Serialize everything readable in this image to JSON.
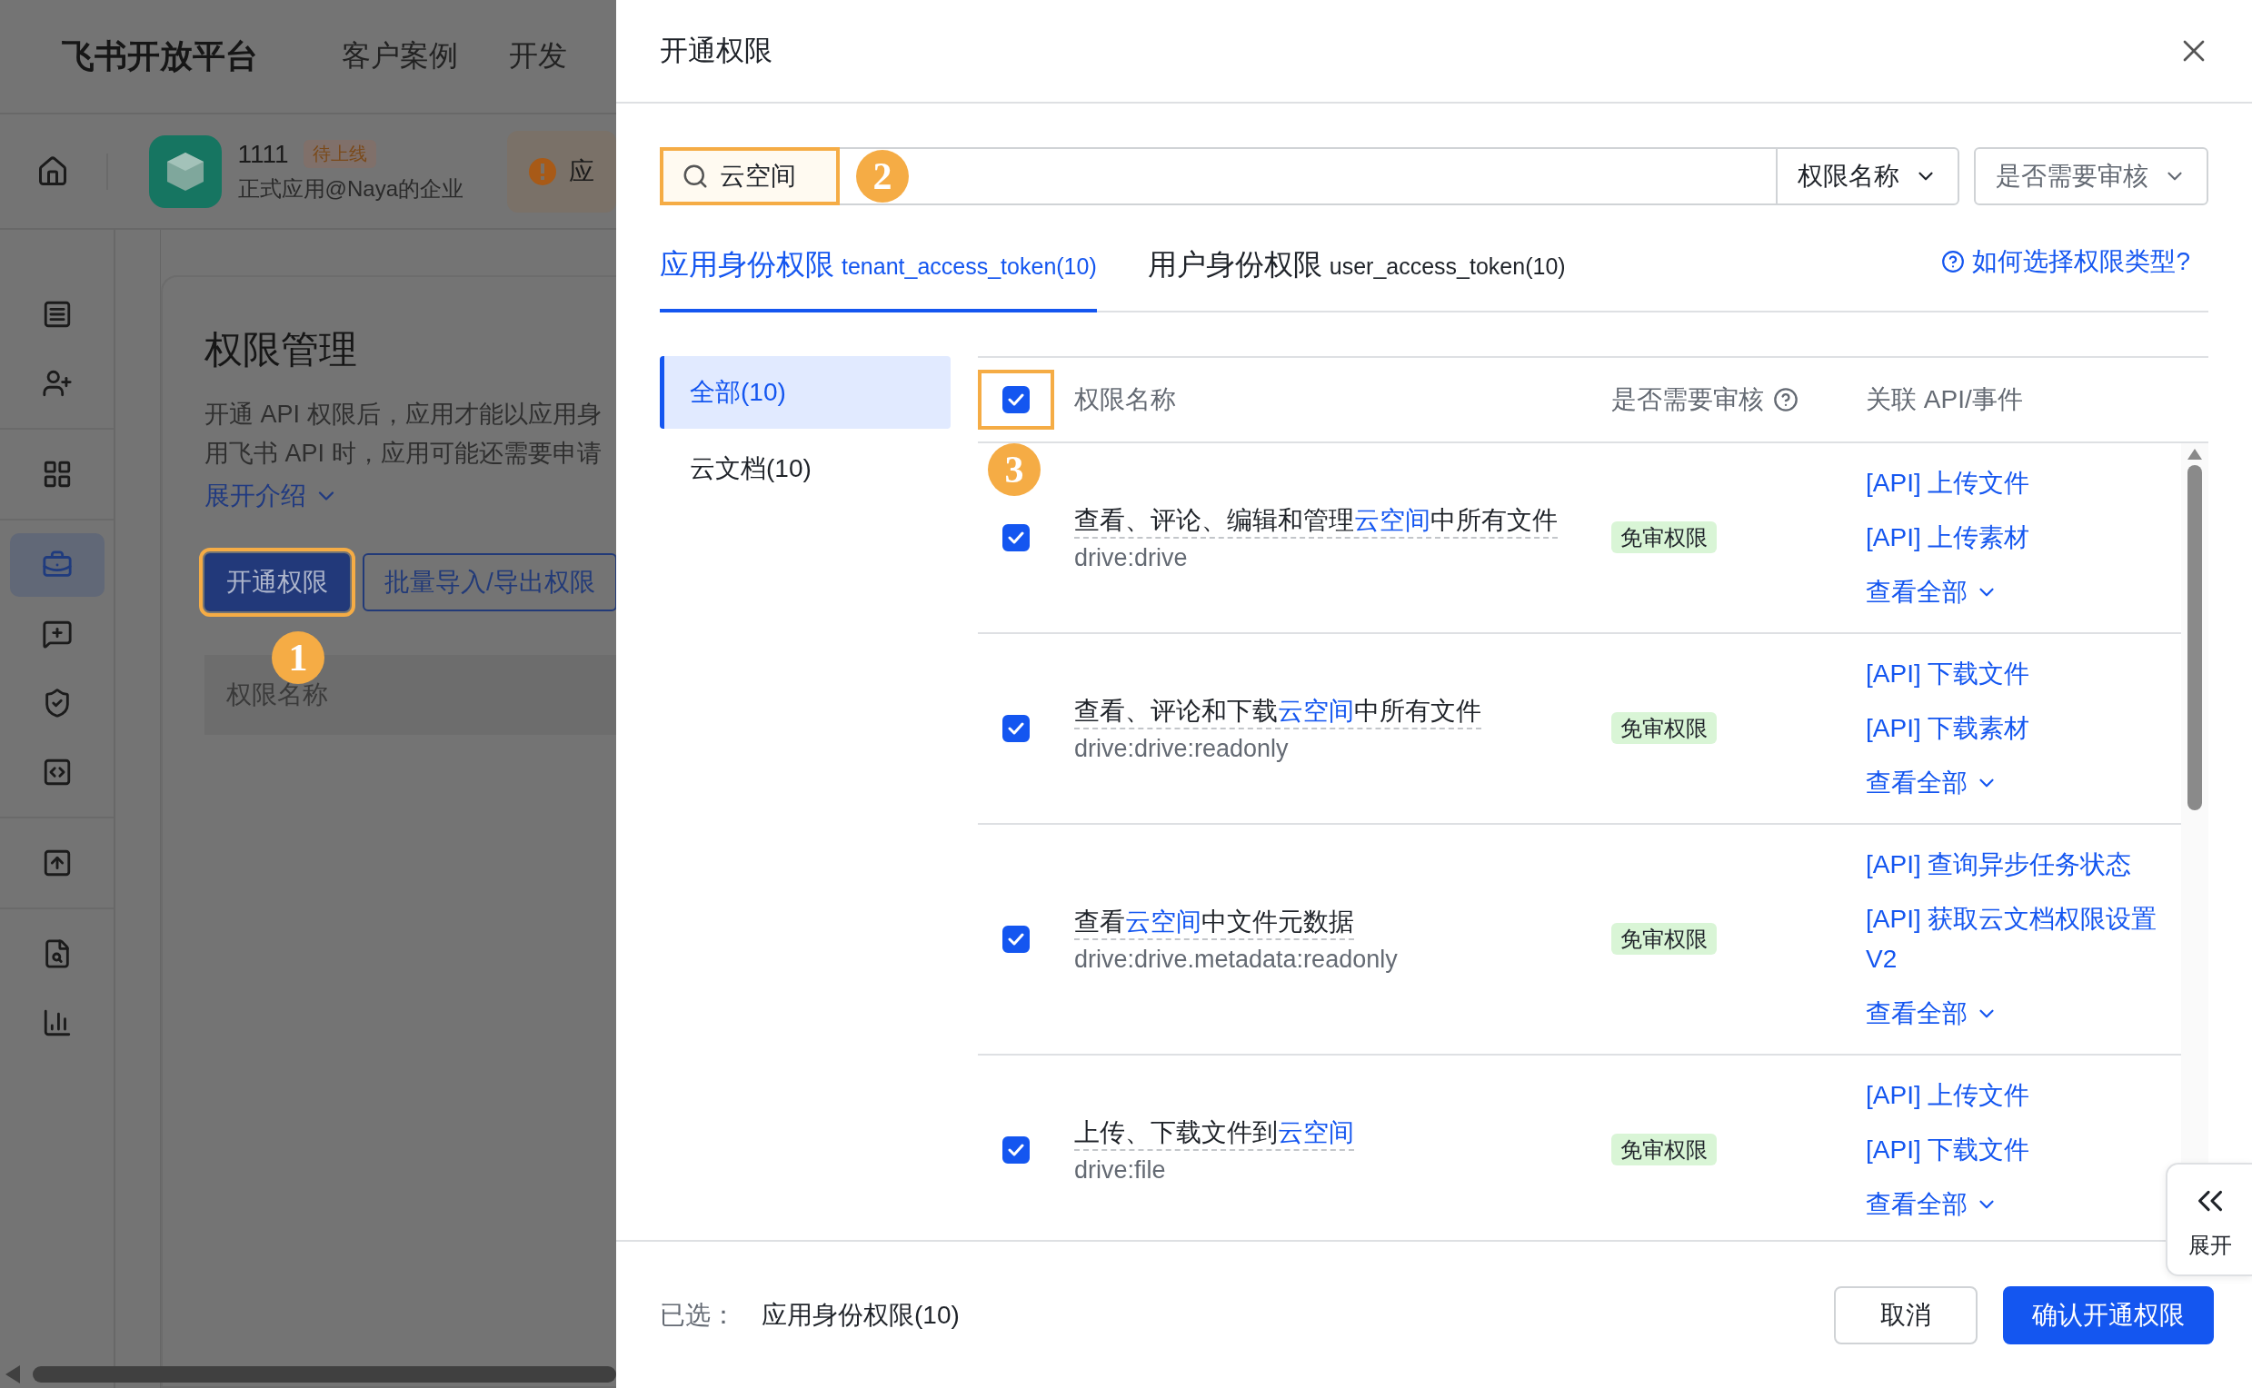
{
  "backdrop": {
    "brand": "飞书开放平台",
    "nav": [
      "客户案例",
      "开发"
    ],
    "app": {
      "name": "1111",
      "status": "待上线",
      "subtitle": "正式应用@Naya的企业",
      "notice": "应"
    },
    "sidebar": [
      [
        {
          "selected": false
        },
        {
          "selected": false
        }
      ],
      [
        {
          "selected": false
        }
      ],
      [
        {
          "selected": true
        },
        {
          "selected": false
        },
        {
          "selected": false
        },
        {
          "selected": false
        }
      ],
      [
        {
          "selected": false
        }
      ],
      [
        {
          "selected": false
        },
        {
          "selected": false
        }
      ]
    ],
    "card": {
      "title": "权限管理",
      "intro_lines": [
        "开通 API 权限后，应用才能以应用身",
        "用飞书 API 时，应用可能还需要申请"
      ],
      "expand_link": "展开介绍",
      "buttons": [
        {
          "label": "开通权限",
          "kind": "primary",
          "callout": "1"
        },
        {
          "label": "批量导入/导出权限",
          "kind": "outline"
        }
      ],
      "table_header": "权限名称"
    }
  },
  "modal": {
    "title": "开通权限",
    "search": {
      "value": "云空间",
      "callout": "2"
    },
    "filters": [
      {
        "label": "权限名称",
        "kind": "attached"
      },
      {
        "label": "是否需要审核",
        "kind": "placeholder"
      }
    ],
    "tabs": [
      {
        "label": "应用身份权限",
        "token": "tenant_access_token(10)",
        "selected": true
      },
      {
        "label": "用户身份权限",
        "token": "user_access_token(10)",
        "selected": false
      }
    ],
    "help_link": "如何选择权限类型?",
    "categories": [
      {
        "label": "全部(10)",
        "selected": true
      },
      {
        "label": "云文档(10)",
        "selected": false
      }
    ],
    "table": {
      "columns": [
        "权限名称",
        "是否需要审核",
        "关联 API/事件"
      ],
      "select_all": true,
      "callout": "3",
      "rows": [
        {
          "checked": true,
          "name": [
            {
              "text": "查看、评论、编辑和管理",
              "match": false
            },
            {
              "text": "云空间",
              "match": true
            },
            {
              "text": "中所有文件",
              "match": false
            }
          ],
          "scope": "drive:drive",
          "review": "免审权限",
          "apis": [
            "[API] 上传文件",
            "[API] 上传素材"
          ],
          "more": "查看全部"
        },
        {
          "checked": true,
          "name": [
            {
              "text": "查看、评论和下载",
              "match": false
            },
            {
              "text": "云空间",
              "match": true
            },
            {
              "text": "中所有文件",
              "match": false
            }
          ],
          "scope": "drive:drive:readonly",
          "review": "免审权限",
          "apis": [
            "[API] 下载文件",
            "[API] 下载素材"
          ],
          "more": "查看全部"
        },
        {
          "checked": true,
          "name": [
            {
              "text": "查看",
              "match": false
            },
            {
              "text": "云空间",
              "match": true
            },
            {
              "text": "中文件元数据",
              "match": false
            }
          ],
          "scope": "drive:drive.metadata:readonly",
          "review": "免审权限",
          "apis": [
            "[API] 查询异步任务状态",
            "[API] 获取云文档权限设置V2"
          ],
          "more": "查看全部"
        },
        {
          "checked": true,
          "name": [
            {
              "text": "上传、下载文件到",
              "match": false
            },
            {
              "text": "云空间",
              "match": true
            }
          ],
          "scope": "drive:file",
          "review": "免审权限",
          "apis": [
            "[API] 上传文件",
            "[API] 下载文件"
          ],
          "more": "查看全部"
        }
      ]
    },
    "footer": {
      "label": "已选：",
      "value": "应用身份权限(10)",
      "buttons": [
        {
          "label": "取消",
          "kind": "default"
        },
        {
          "label": "确认开通权限",
          "kind": "primary"
        }
      ]
    },
    "side_toggle": "展开"
  }
}
